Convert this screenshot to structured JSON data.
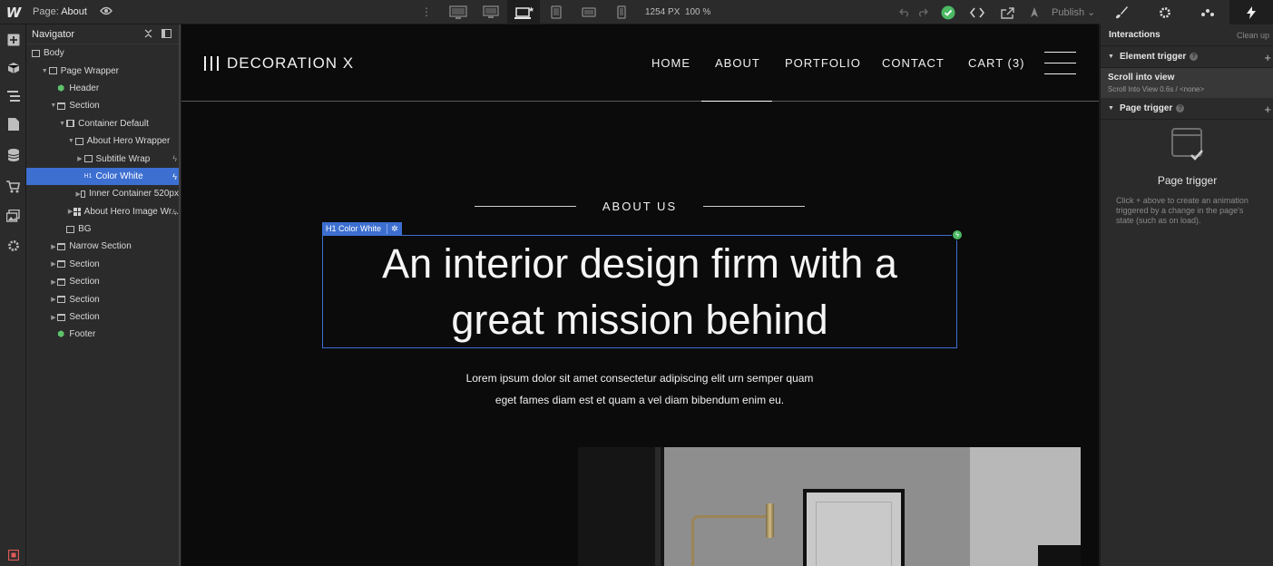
{
  "topbar": {
    "logo": "W",
    "page_label": "Page:",
    "page_name": "About",
    "viewport_width": "1254 PX",
    "zoom": "100 %",
    "publish_label": "Publish",
    "panel_tabs": [
      "style-brush-icon",
      "settings-gear-icon",
      "drops-icon",
      "interactions-bolt-icon"
    ]
  },
  "left_toolbar": {
    "icons": [
      "add-icon",
      "components-box-icon",
      "navigator-icon",
      "pages-icon",
      "cms-database-icon",
      "ecommerce-cart-icon",
      "assets-icon",
      "settings-icon"
    ]
  },
  "navigator": {
    "title": "Navigator",
    "tree": [
      {
        "label": "Body",
        "depth": 0,
        "icon": "box",
        "caret": ""
      },
      {
        "label": "Page Wrapper",
        "depth": 1,
        "icon": "box",
        "caret": "open"
      },
      {
        "label": "Header",
        "depth": 2,
        "icon": "sym",
        "caret": ""
      },
      {
        "label": "Section",
        "depth": 2,
        "icon": "sec",
        "caret": "open"
      },
      {
        "label": "Container Default",
        "depth": 3,
        "icon": "cont",
        "caret": "open"
      },
      {
        "label": "About Hero Wrapper",
        "depth": 4,
        "icon": "box",
        "caret": "open"
      },
      {
        "label": "Subtitle Wrap",
        "depth": 5,
        "icon": "box",
        "caret": "closed",
        "bolt": true
      },
      {
        "label": "Color White",
        "depth": 5,
        "icon": "h1",
        "caret": "",
        "bolt": true,
        "selected": true
      },
      {
        "label": "Inner Container 520px",
        "depth": 5,
        "icon": "box",
        "caret": "closed"
      },
      {
        "label": "About Hero Image Wr...",
        "depth": 4,
        "icon": "grid",
        "caret": "closed",
        "bolt": true
      },
      {
        "label": "BG",
        "depth": 3,
        "icon": "box",
        "caret": ""
      },
      {
        "label": "Narrow Section",
        "depth": 2,
        "icon": "sec",
        "caret": "closed"
      },
      {
        "label": "Section",
        "depth": 2,
        "icon": "sec",
        "caret": "closed"
      },
      {
        "label": "Section",
        "depth": 2,
        "icon": "sec",
        "caret": "closed"
      },
      {
        "label": "Section",
        "depth": 2,
        "icon": "sec",
        "caret": "closed"
      },
      {
        "label": "Section",
        "depth": 2,
        "icon": "sec",
        "caret": "closed"
      },
      {
        "label": "Footer",
        "depth": 2,
        "icon": "sym",
        "caret": ""
      }
    ]
  },
  "site": {
    "brand": "DECORATION X",
    "menu": [
      "HOME",
      "ABOUT",
      "PORTFOLIO",
      "CONTACT",
      "CART (3)"
    ],
    "subtitle": "ABOUT US",
    "selected_tag": "Color White",
    "heading_line1": "An interior design firm with a",
    "heading_line2": "great mission behind",
    "lede_line1": "Lorem ipsum dolor sit amet consectetur adipiscing elit urn semper quam",
    "lede_line2": "eget fames diam est et quam a vel diam bibendum enim eu."
  },
  "interactions": {
    "title": "Interactions",
    "clean_up": "Clean up",
    "element_trigger_label": "Element trigger",
    "trigger_name": "Scroll into view",
    "trigger_detail": "Scroll Into View 0.6s / <none>",
    "page_trigger_label": "Page trigger",
    "empty_title": "Page trigger",
    "empty_desc": "Click + above to create an animation triggered by a change in the page's state (such as on load)."
  },
  "colors": {
    "selection": "#3d6fd1",
    "symbol_green": "#5ec26a",
    "status_green": "#4cb964"
  }
}
